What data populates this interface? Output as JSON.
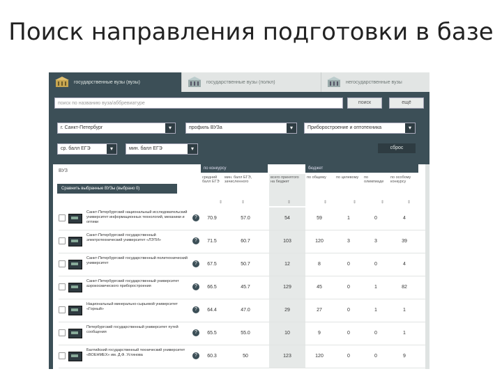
{
  "slide": {
    "title": "Поиск направления подготовки в базе"
  },
  "tabs": [
    {
      "label": "государственные вузы (вузы)",
      "icon": "university-icon",
      "active": true
    },
    {
      "label": "государственные вузы (полкл)",
      "icon": "university-icon",
      "active": false
    },
    {
      "label": "негосударственные вузы",
      "icon": "university-icon",
      "active": false
    }
  ],
  "search": {
    "placeholder": "поиск по названию вуза/аббревиатуре",
    "button": "поиск",
    "more": "ещё"
  },
  "filters": {
    "city": "г. Санкт-Петербург",
    "profile": "профиль ВУЗа",
    "direction": "Приборостроение и оптотехника",
    "min_ege": "ср. балл ЕГЭ",
    "max_ege": "мин. балл ЕГЭ",
    "reset": "сброс"
  },
  "table": {
    "vuz_label": "ВУЗ",
    "compare_button": "Сравнить выбранные ВУЗы (выбрано 0)",
    "group_contest": "по конкурсу",
    "group_places": "бюджет",
    "columns": [
      "средний балл ЕГЭ",
      "мин. балл ЕГЭ, зачисленного",
      "всего принятого на бюджет",
      "по общему",
      "по целевому",
      "по олимпиаде",
      "по особому конкурсу"
    ],
    "rows": [
      {
        "name": "Санкт-Петербургский национальный исследовательский университет информационных технологий, механики и оптики",
        "values": [
          "70.9",
          "57.0",
          "54",
          "59",
          "1",
          "0",
          "4"
        ]
      },
      {
        "name": "Санкт-Петербургский государственный электротехнический университет «ЛЭТИ»",
        "values": [
          "71.5",
          "60.7",
          "103",
          "120",
          "3",
          "3",
          "39"
        ]
      },
      {
        "name": "Санкт-Петербургский государственный политехнический университет",
        "values": [
          "67.5",
          "50.7",
          "12",
          "8",
          "0",
          "0",
          "4"
        ]
      },
      {
        "name": "Санкт-Петербургский государственный университет аэрокосмического приборостроения",
        "values": [
          "66.5",
          "45.7",
          "129",
          "45",
          "0",
          "1",
          "82"
        ]
      },
      {
        "name": "Национальный минерально-сырьевой университет «Горный»",
        "values": [
          "64.4",
          "47.0",
          "29",
          "27",
          "0",
          "1",
          "1"
        ]
      },
      {
        "name": "Петербургский государственный университет путей сообщения",
        "values": [
          "65.5",
          "55.0",
          "10",
          "9",
          "0",
          "0",
          "1"
        ]
      },
      {
        "name": "Балтийский государственный технический университет «ВОЕНМЕХ» им. Д.Ф. Устинова",
        "values": [
          "60.3",
          "50",
          "123",
          "120",
          "0",
          "0",
          "9"
        ]
      }
    ]
  }
}
